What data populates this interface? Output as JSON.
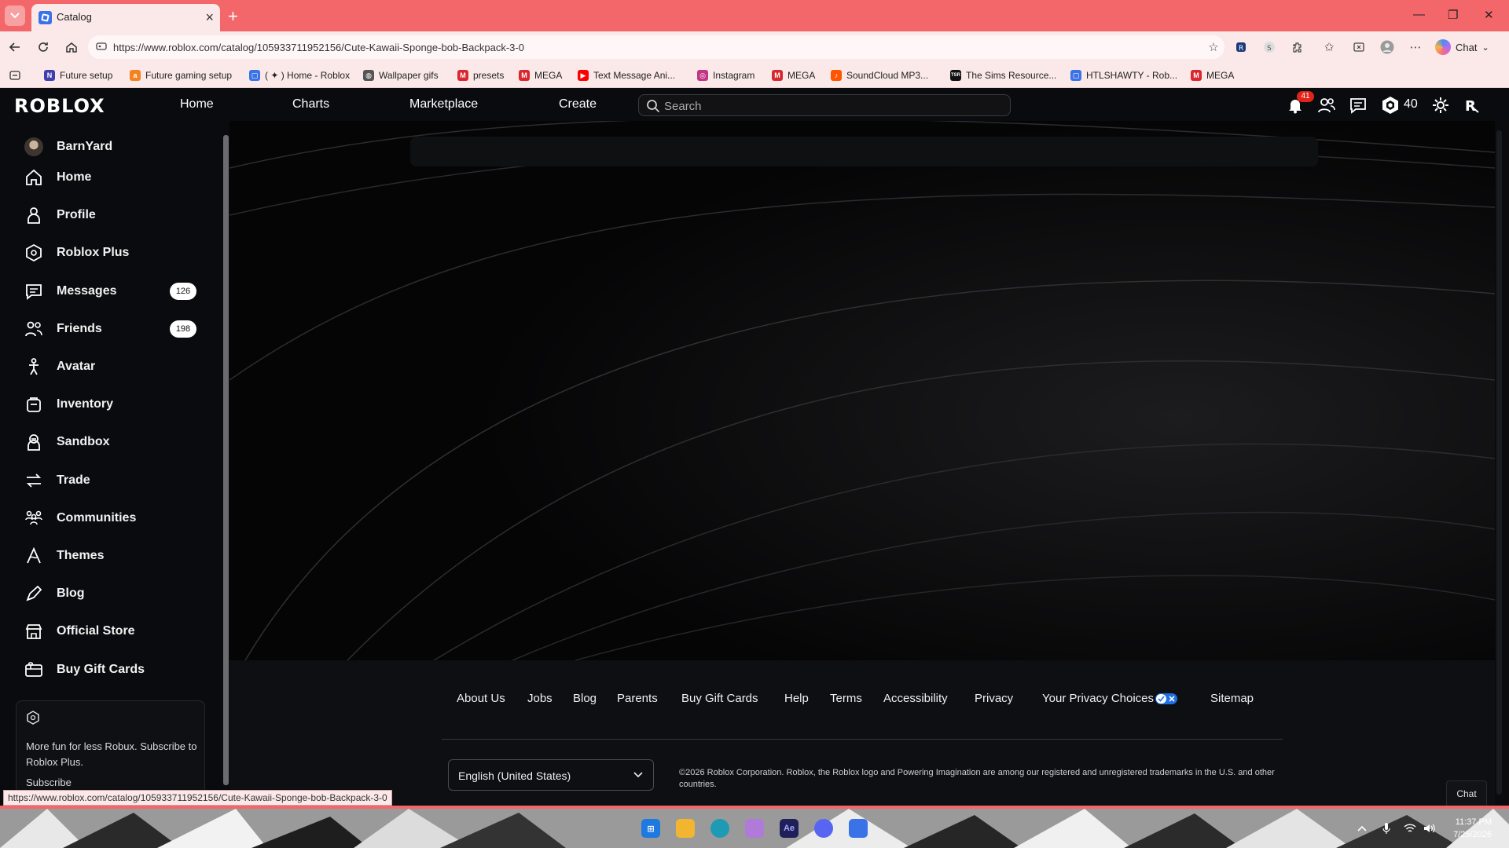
{
  "browser": {
    "tab_title": "Catalog",
    "url": "https://www.roblox.com/catalog/105933711952156/Cute-Kawaii-Sponge-bob-Backpack-3-0",
    "chat_label": "Chat",
    "bookmarks": [
      {
        "label": "Future setup",
        "icon": "notion-icon",
        "color": "#3f3fb0"
      },
      {
        "label": "Future gaming setup",
        "icon": "amazon-icon",
        "color": "#f58220"
      },
      {
        "label": "( ✦ ) Home - Roblox",
        "icon": "roblox-icon",
        "color": "#3a72e8"
      },
      {
        "label": "Wallpaper gifs",
        "icon": "globe-icon",
        "color": "#555555"
      },
      {
        "label": "presets",
        "icon": "mega-icon",
        "color": "#d9272e"
      },
      {
        "label": "MEGA",
        "icon": "mega-icon",
        "color": "#d9272e"
      },
      {
        "label": "Text Message Ani...",
        "icon": "youtube-icon",
        "color": "#ff0000"
      },
      {
        "label": "Instagram",
        "icon": "instagram-icon",
        "color": "#c13584"
      },
      {
        "label": "MEGA",
        "icon": "mega-icon",
        "color": "#d9272e"
      },
      {
        "label": "SoundCloud MP3...",
        "icon": "soundcloud-icon",
        "color": "#ff5500"
      },
      {
        "label": "The Sims Resource...",
        "icon": "tsr-icon",
        "color": "#111111"
      },
      {
        "label": "HTLSHAWTY - Rob...",
        "icon": "roblox-icon",
        "color": "#3a72e8"
      },
      {
        "label": "MEGA",
        "icon": "mega-icon",
        "color": "#d9272e"
      }
    ],
    "status_url": "https://www.roblox.com/catalog/105933711952156/Cute-Kawaii-Sponge-bob-Backpack-3-0"
  },
  "topbar": {
    "logo": "ROBLOX",
    "nav": [
      "Home",
      "Charts",
      "Marketplace",
      "Create"
    ],
    "search_placeholder": "Search",
    "notification_count": "41",
    "robux": "40"
  },
  "sidebar": {
    "username": "BarnYard",
    "items": [
      {
        "label": "Home",
        "icon": "home-icon"
      },
      {
        "label": "Profile",
        "icon": "profile-icon"
      },
      {
        "label": "Roblox Plus",
        "icon": "roblox-plus-icon"
      },
      {
        "label": "Messages",
        "icon": "messages-icon",
        "badge": "126"
      },
      {
        "label": "Friends",
        "icon": "friends-icon",
        "badge": "198"
      },
      {
        "label": "Avatar",
        "icon": "avatar-icon"
      },
      {
        "label": "Inventory",
        "icon": "inventory-icon"
      },
      {
        "label": "Sandbox",
        "icon": "sandbox-icon"
      },
      {
        "label": "Trade",
        "icon": "trade-icon"
      },
      {
        "label": "Communities",
        "icon": "communities-icon"
      },
      {
        "label": "Themes",
        "icon": "themes-icon"
      },
      {
        "label": "Blog",
        "icon": "blog-icon"
      },
      {
        "label": "Official Store",
        "icon": "store-icon"
      },
      {
        "label": "Buy Gift Cards",
        "icon": "gift-card-icon"
      }
    ],
    "plus_card": {
      "text": "More fun for less Robux. Subscribe to Roblox Plus.",
      "subscribe": "Subscribe"
    }
  },
  "footer": {
    "links": [
      "About Us",
      "Jobs",
      "Blog",
      "Parents",
      "Buy Gift Cards",
      "Help",
      "Terms",
      "Accessibility",
      "Privacy",
      "Your Privacy Choices",
      "Sitemap"
    ],
    "language": "English (United States)",
    "copyright": "©2026 Roblox Corporation. Roblox, the Roblox logo and Powering Imagination are among our registered and unregistered trademarks in the U.S. and other countries.",
    "chat": "Chat"
  },
  "taskbar": {
    "time": "11:37 PM",
    "date": "7/25/2026",
    "apps": [
      "windows-start-icon",
      "file-explorer-icon",
      "edge-icon",
      "app-icon",
      "after-effects-icon",
      "discord-icon",
      "roblox-icon"
    ]
  },
  "colors": {
    "chrome_accent": "#f3676a",
    "page_bg": "#050506",
    "badge_red": "#e2231a"
  }
}
